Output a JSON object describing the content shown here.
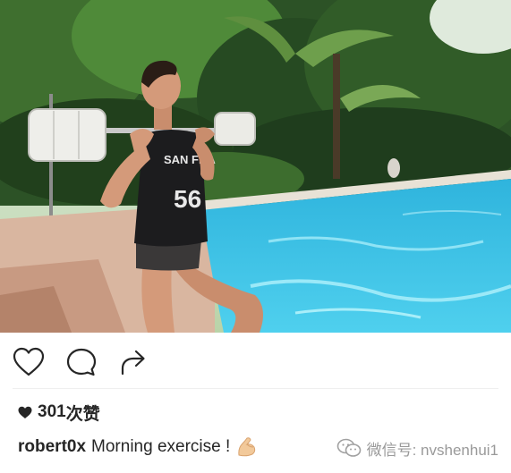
{
  "photo": {
    "subject": "man-lifting-barbell-by-pool",
    "jersey_text": "SAN FRA",
    "jersey_number": "56",
    "colors": {
      "foliage_dark": "#1f3d1d",
      "foliage_light": "#5f8f3f",
      "pool": "#3cc4e6",
      "pool_light": "#8fe3f5",
      "deck": "#d9b6a0",
      "jersey": "#1c1c1e",
      "skin": "#d49a7a"
    }
  },
  "actions": {
    "like_icon": "heart-outline-icon",
    "comment_icon": "comment-bubble-icon",
    "share_icon": "share-arrow-icon"
  },
  "likes": {
    "icon": "heart-filled-icon",
    "count": "301",
    "suffix": "次赞"
  },
  "caption": {
    "username": "robert0x",
    "text": "Morning exercise !",
    "emoji": "flexed-biceps-emoji"
  },
  "watermark": {
    "logo": "wechat-logo-icon",
    "text": "微信号: nvshenhui1"
  }
}
